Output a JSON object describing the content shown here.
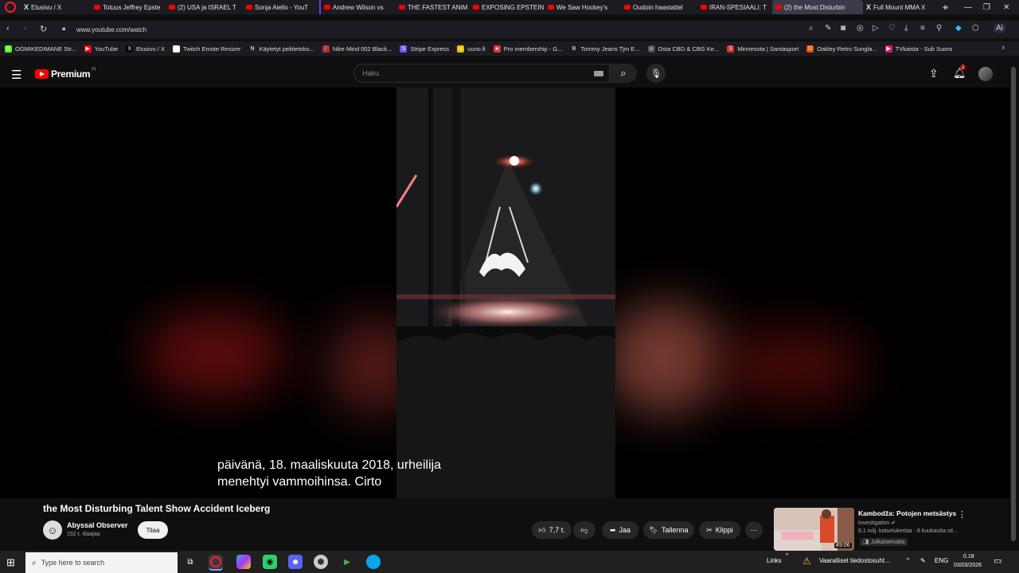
{
  "tabs": [
    {
      "label": "Etusivu / X",
      "icon": "x-icon"
    },
    {
      "label": "Totuus Jeffrey Epste",
      "icon": "youtube-icon"
    },
    {
      "label": "(2) USA ja ISRAEL T",
      "icon": "youtube-icon"
    },
    {
      "label": "Sonja Aiello - YouT",
      "icon": "youtube-icon"
    },
    {
      "label": "Andrew Wilson vs",
      "icon": "youtube-icon"
    },
    {
      "label": "THE FASTEST ANIM",
      "icon": "youtube-icon"
    },
    {
      "label": "EXPOSING EPSTEIN",
      "icon": "youtube-icon"
    },
    {
      "label": "We Saw Hockey's",
      "icon": "youtube-icon"
    },
    {
      "label": "Oudoin haastattel",
      "icon": "youtube-icon"
    },
    {
      "label": "IRAN-SPESIAALI: T",
      "icon": "youtube-icon"
    },
    {
      "label": "(2) the Most Disturbin",
      "icon": "youtube-icon",
      "active": true
    },
    {
      "label": "Full Mount MMA X",
      "icon": "x-icon"
    }
  ],
  "address": {
    "url": "www.youtube.com/watch"
  },
  "bookmarks": [
    {
      "label": "OGMIKEDIMANE Str...",
      "color": "#53fc18",
      "glyph": "K"
    },
    {
      "label": "YouTube",
      "color": "#ff0000",
      "glyph": "▶"
    },
    {
      "label": "Etusivu / X",
      "color": "#000000",
      "glyph": "X"
    },
    {
      "label": "Twitch Emote Resizer",
      "color": "#ffffff",
      "glyph": ""
    },
    {
      "label": "Käytetyt pelitietoko...",
      "color": "#222222",
      "glyph": "N"
    },
    {
      "label": "Nike Mind 002 Black...",
      "color": "#b03030",
      "glyph": "/"
    },
    {
      "label": "Stripe Express",
      "color": "#635bff",
      "glyph": "S"
    },
    {
      "label": "uuno.fi",
      "color": "#e6c200",
      "glyph": "u"
    },
    {
      "label": "Pro membership - G...",
      "color": "#e53935",
      "glyph": "●"
    },
    {
      "label": "Tommy Jeans Tjm E...",
      "color": "#1a1a1a",
      "glyph": "B"
    },
    {
      "label": "Osta CBD & CBG Ke...",
      "color": "#444444",
      "glyph": "◎"
    },
    {
      "label": "Minnesota | Santasport",
      "color": "#d32f2f",
      "glyph": "S"
    },
    {
      "label": "Oakley Retro Sungla...",
      "color": "#e65100",
      "glyph": "O"
    },
    {
      "label": "TVkaista - Sub Suora",
      "color": "#d81b60",
      "glyph": "▶"
    }
  ],
  "youtube": {
    "brand": "Premium",
    "brand_sup": "FI",
    "search_placeholder": "Haku",
    "notification_count": "2"
  },
  "video": {
    "caption_line1": "päivänä, 18. maaliskuuta 2018, urheilija",
    "caption_line2": "menehtyi vammoihinsa.  Cirto",
    "title": "the Most Disturbing Talent Show Accident Iceberg",
    "channel": "Abyssal Observer",
    "subscribers": "152 t. tilaajaa",
    "subscribe_label": "Tilaa",
    "likes": "7,7 t.",
    "share_label": "Jaa",
    "save_label": "Tallenna",
    "clip_label": "Klippi"
  },
  "up_next": {
    "title": "Kambodža: Potojen metsästys",
    "channel": "Investigation",
    "stats": "8,1 milj. katselukertaa · 8 kuukautta sit...",
    "badge": "Julkaisematta",
    "duration": "49:06"
  },
  "taskbar": {
    "search_placeholder": "Type here to search",
    "links_label": "Links",
    "notice": "Vaaralliset tiedostosuht...",
    "lang": "ENG",
    "time": "0.18",
    "date": "03/03/2026"
  }
}
